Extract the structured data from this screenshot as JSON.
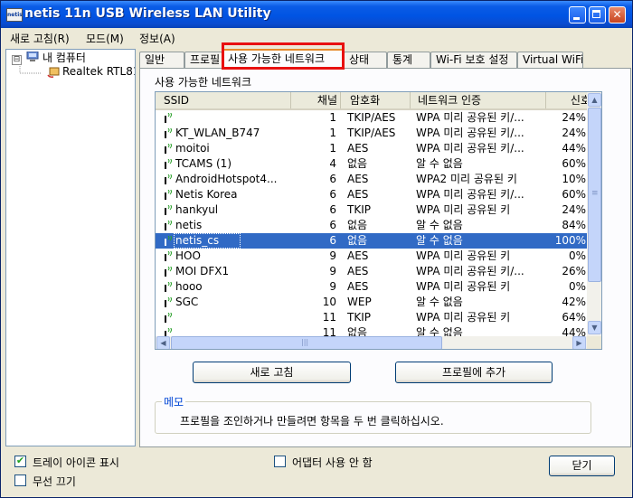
{
  "window": {
    "title": "netis 11n USB Wireless LAN Utility",
    "app_icon_text": "netis"
  },
  "menu": [
    "새로 고침(R)",
    "모드(M)",
    "정보(A)"
  ],
  "tree": {
    "root": "내 컴퓨터",
    "child": "Realtek RTL81",
    "expander": "⊟"
  },
  "tabs": [
    "일반",
    "프로필",
    "사용 가능한 네트워크",
    "상태",
    "통계",
    "Wi-Fi 보호 설정",
    "Virtual WiFi"
  ],
  "active_tab_index": 2,
  "group_label": "사용 가능한 네트워크",
  "columns": [
    "SSID",
    "채널",
    "암호화",
    "네트워크 인증",
    "신호"
  ],
  "networks": [
    {
      "ssid": "",
      "channel": "1",
      "encryption": "TKIP/AES",
      "auth": "WPA 미리 공유된 키/...",
      "signal": "24%"
    },
    {
      "ssid": "KT_WLAN_B747",
      "channel": "1",
      "encryption": "TKIP/AES",
      "auth": "WPA 미리 공유된 키/...",
      "signal": "24%"
    },
    {
      "ssid": "moitoi",
      "channel": "1",
      "encryption": "AES",
      "auth": "WPA 미리 공유된 키/...",
      "signal": "44%"
    },
    {
      "ssid": "TCAMS (1)",
      "channel": "4",
      "encryption": "없음",
      "auth": "알 수 없음",
      "signal": "60%"
    },
    {
      "ssid": "AndroidHotspot4...",
      "channel": "6",
      "encryption": "AES",
      "auth": "WPA2 미리 공유된 키",
      "signal": "10%"
    },
    {
      "ssid": "Netis Korea",
      "channel": "6",
      "encryption": "AES",
      "auth": "WPA 미리 공유된 키/...",
      "signal": "60%"
    },
    {
      "ssid": "hankyul",
      "channel": "6",
      "encryption": "TKIP",
      "auth": "WPA 미리 공유된 키",
      "signal": "24%"
    },
    {
      "ssid": "netis",
      "channel": "6",
      "encryption": "없음",
      "auth": "알 수 없음",
      "signal": "84%"
    },
    {
      "ssid": "netis_cs",
      "channel": "6",
      "encryption": "없음",
      "auth": "알 수 없음",
      "signal": "100%",
      "selected": true
    },
    {
      "ssid": "HOO",
      "channel": "9",
      "encryption": "AES",
      "auth": "WPA 미리 공유된 키",
      "signal": "0%"
    },
    {
      "ssid": "MOI DFX1",
      "channel": "9",
      "encryption": "AES",
      "auth": "WPA 미리 공유된 키/...",
      "signal": "26%"
    },
    {
      "ssid": "hooo",
      "channel": "9",
      "encryption": "AES",
      "auth": "WPA 미리 공유된 키",
      "signal": "0%"
    },
    {
      "ssid": "SGC",
      "channel": "10",
      "encryption": "WEP",
      "auth": "알 수 없음",
      "signal": "42%"
    },
    {
      "ssid": "",
      "channel": "11",
      "encryption": "TKIP",
      "auth": "WPA 미리 공유된 키",
      "signal": "64%"
    },
    {
      "ssid": "",
      "channel": "11",
      "encryption": "없음",
      "auth": "알 수 없음",
      "signal": "44%"
    }
  ],
  "buttons": {
    "refresh": "새로 고침",
    "add_profile": "프로필에 추가",
    "close": "닫기"
  },
  "memo": {
    "label": "메모",
    "text": "프로필을 조인하거나 만들려면 항목을 두 번 클릭하십시오."
  },
  "checkboxes": {
    "tray_icon": {
      "label": "트레이 아이콘 표시",
      "checked": true
    },
    "radio_off": {
      "label": "무선 끄기",
      "checked": false
    },
    "disable_adapter": {
      "label": "어댑터 사용 안 함",
      "checked": false
    }
  },
  "scroll_arrows": {
    "up": "▲",
    "down": "▼",
    "left": "◀",
    "right": "▶",
    "grip": "≡",
    "hgrip": "|||"
  },
  "window_buttons": {
    "close": "✕"
  },
  "colors": {
    "selection": "#316ac5",
    "title_bar": "#0054e3",
    "highlight_box": "#e81010",
    "tab_accent": "#e68b2c",
    "check": "#21a121"
  }
}
